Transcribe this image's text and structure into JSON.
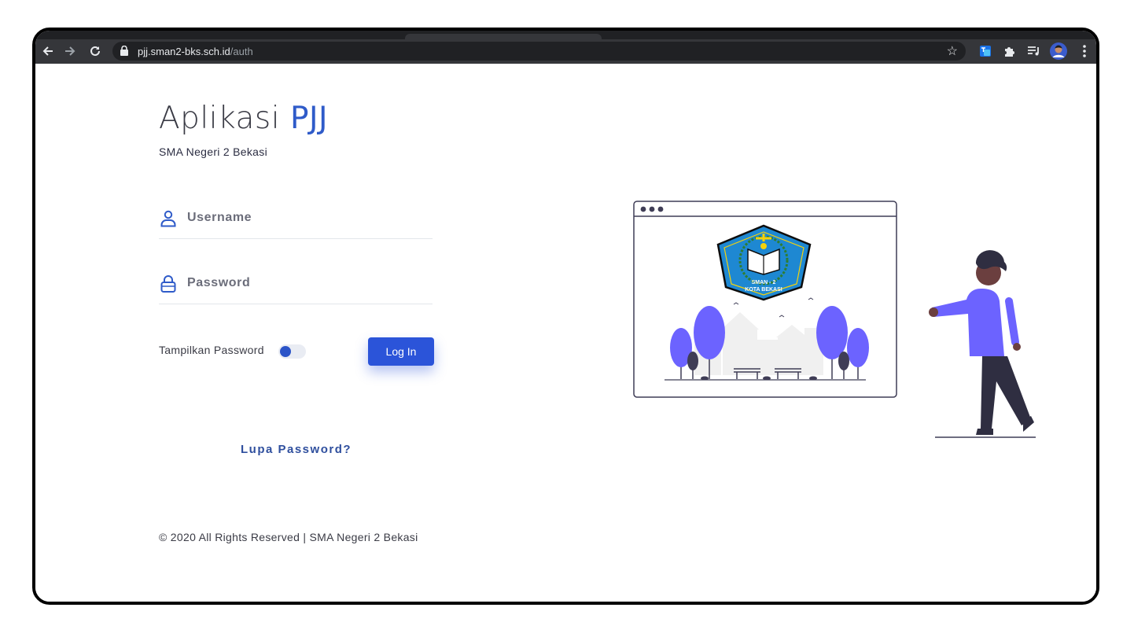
{
  "browser": {
    "url_host": "pjj.sman2-bks.sch.id",
    "url_path": "/auth",
    "icons": [
      "back-icon",
      "forward-icon",
      "reload-icon",
      "lock-icon",
      "star-icon",
      "extension-translate-icon",
      "extensions-puzzle-icon",
      "media-control-icon",
      "profile-avatar-icon",
      "kebab-menu-icon"
    ]
  },
  "header": {
    "title_main": "Aplikasi ",
    "title_accent": "PJJ",
    "subtitle": "SMA Negeri 2 Bekasi"
  },
  "form": {
    "username_placeholder": "Username",
    "password_placeholder": "Password",
    "show_password_label": "Tampilkan Password",
    "login_label": "Log In",
    "forgot_label": "Lupa Password?"
  },
  "footer": {
    "text": "© 2020 All Rights Reserved | SMA Negeri 2 Bekasi"
  },
  "illustration": {
    "logo_line1": "SMAN - 2",
    "logo_line2": "KOTA BEKASI"
  },
  "colors": {
    "accent": "#2f5bc9",
    "button": "#2b54d9",
    "tree_purple": "#6c63ff",
    "logo_blue": "#1e88d2",
    "logo_yellow": "#f5d20a"
  }
}
